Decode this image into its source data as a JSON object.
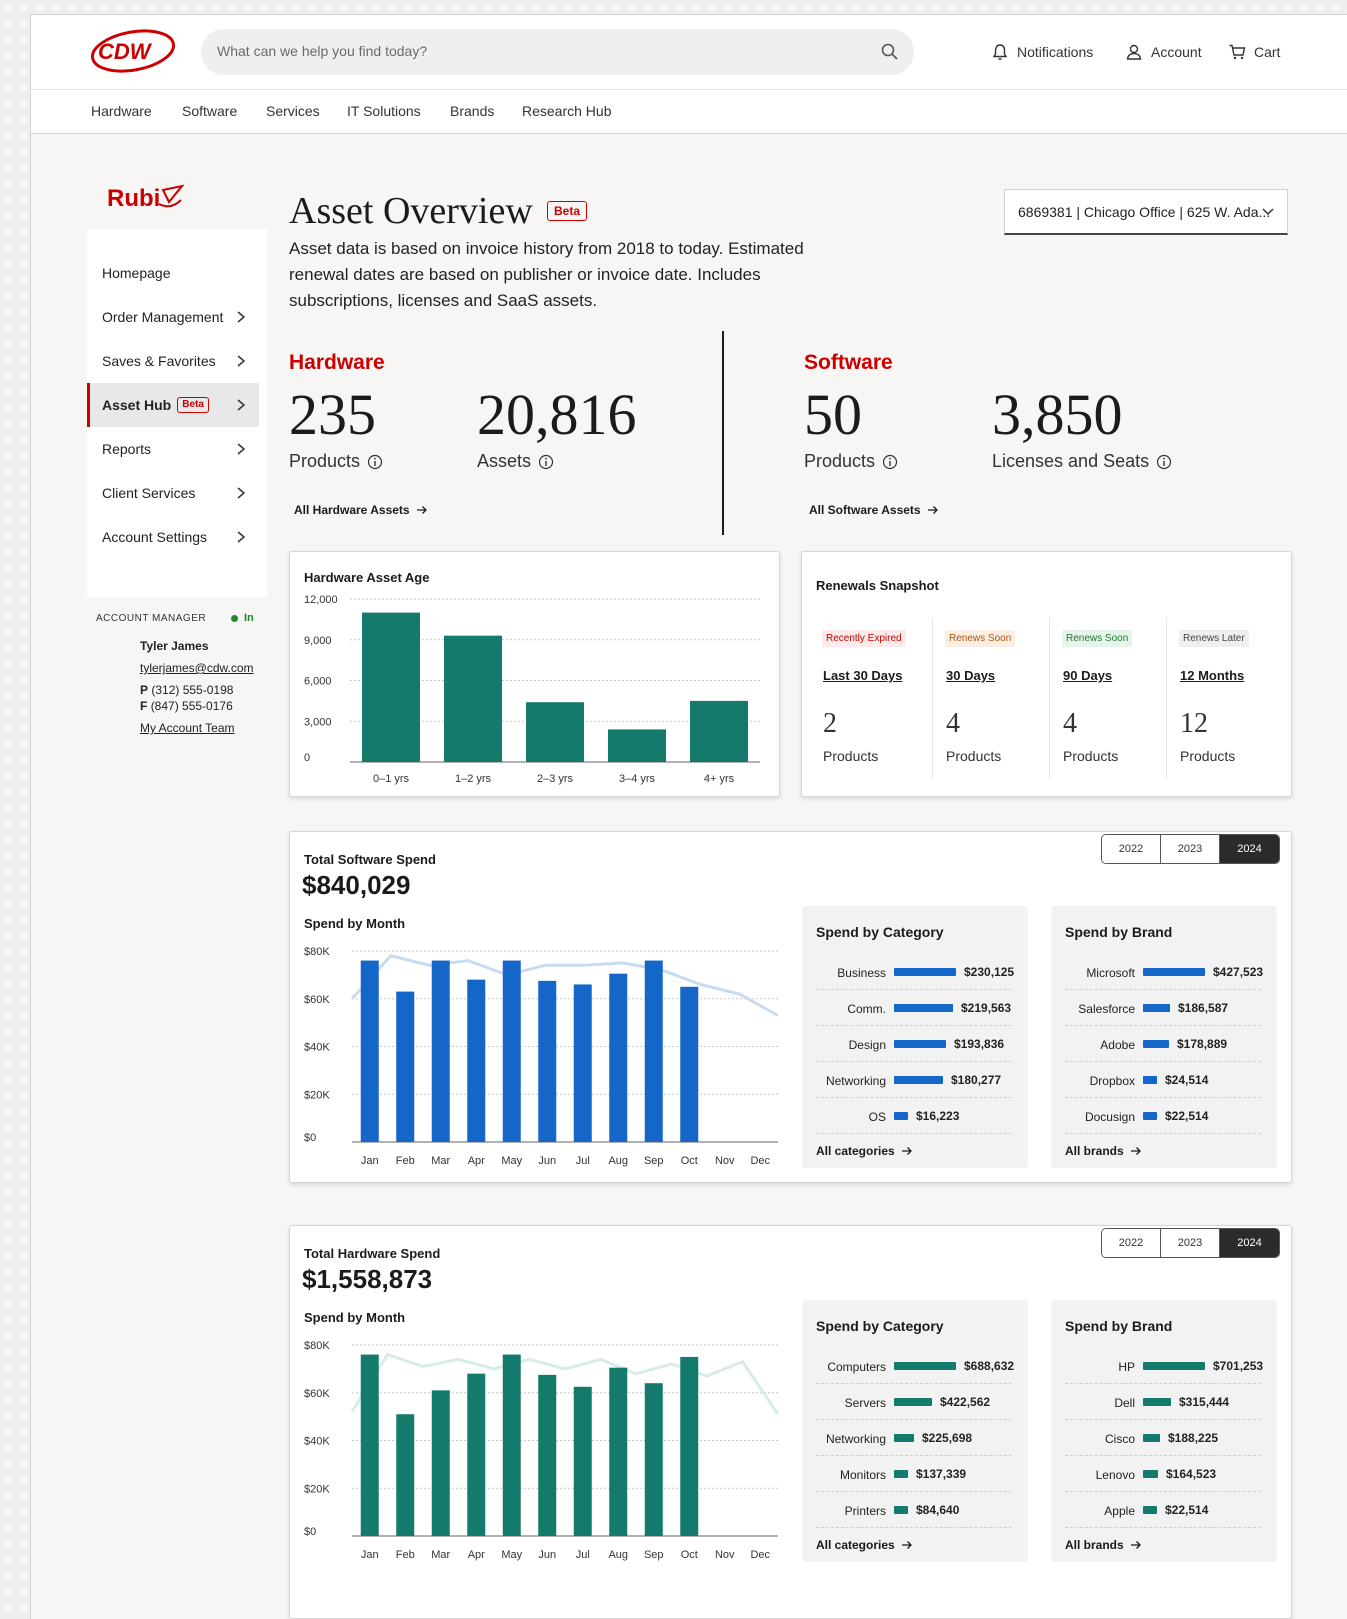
{
  "header": {
    "logo_text": "CDW",
    "search_placeholder": "What can we help you find today?",
    "notifications": "Notifications",
    "account": "Account",
    "cart": "Cart"
  },
  "nav": [
    "Hardware",
    "Software",
    "Services",
    "IT Solutions",
    "Brands",
    "Research Hub"
  ],
  "sidebar": {
    "brand": "Rubi",
    "items": [
      {
        "label": "Homepage"
      },
      {
        "label": "Order Management"
      },
      {
        "label": "Saves & Favorites"
      },
      {
        "label": "Asset Hub",
        "badge": "Beta"
      },
      {
        "label": "Reports"
      },
      {
        "label": "Client Services"
      },
      {
        "label": "Account Settings"
      }
    ],
    "account_manager": {
      "label": "ACCOUNT MANAGER",
      "status": "In",
      "name": "Tyler James",
      "email": "tylerjames@cdw.com",
      "phone_prefix": "P",
      "phone": "(312) 555-0198",
      "fax_prefix": "F",
      "fax": "(847) 555-0176",
      "team_link": "My Account Team"
    }
  },
  "page": {
    "title": "Asset Overview",
    "badge": "Beta",
    "intro": "Asset data is based on invoice history from 2018 to today. Estimated renewal dates are based on publisher or invoice date. Includes subscriptions, licenses and SaaS assets.",
    "office_select": "6869381 | Chicago Office | 625 W. Ada..."
  },
  "hardware": {
    "title": "Hardware",
    "products_value": "235",
    "products_label": "Products",
    "assets_value": "20,816",
    "assets_label": "Assets",
    "link": "All Hardware Assets"
  },
  "software": {
    "title": "Software",
    "products_value": "50",
    "products_label": "Products",
    "licenses_value": "3,850",
    "licenses_label": "Licenses and Seats",
    "link": "All Software Assets"
  },
  "asset_age": {
    "title": "Hardware  Asset Age",
    "colors": {
      "bar": "#137a6c"
    }
  },
  "renewals": {
    "title": "Renewals  Snapshot",
    "columns": [
      {
        "badge": "Recently Expired",
        "period": "Last 30 Days",
        "count": "2",
        "unit": "Products",
        "color": "#cc0000",
        "bg": "#fdeaea"
      },
      {
        "badge": "Renews Soon",
        "period": "30 Days",
        "count": "4",
        "unit": "Products",
        "color": "#b5520a",
        "bg": "#fbefe4"
      },
      {
        "badge": "Renews Soon",
        "period": "90 Days",
        "count": "4",
        "unit": "Products",
        "color": "#1e7a2e",
        "bg": "#e7f4e9"
      },
      {
        "badge": "Renews Later",
        "period": "12 Months",
        "count": "12",
        "unit": "Products",
        "color": "#444444",
        "bg": "#efefef"
      }
    ]
  },
  "software_spend": {
    "label": "Total Software Spend",
    "value": "$840,029",
    "month_title": "Spend by Month",
    "years": [
      "2022",
      "2023",
      "2024"
    ],
    "selected_year": "2024",
    "category": {
      "title": "Spend by Category",
      "link": "All categories",
      "rows": [
        {
          "label": "Business",
          "value": "$230,125",
          "amount": 230125
        },
        {
          "label": "Comm.",
          "value": "$219,563",
          "amount": 219563
        },
        {
          "label": "Design",
          "value": "$193,836",
          "amount": 193836
        },
        {
          "label": "Networking",
          "value": "$180,277",
          "amount": 180277
        },
        {
          "label": "OS",
          "value": "$16,223",
          "amount": 16223
        }
      ]
    },
    "brand": {
      "title": "Spend by Brand",
      "link": "All brands",
      "rows": [
        {
          "label": "Microsoft",
          "value": "$427,523",
          "amount": 427523
        },
        {
          "label": "Salesforce",
          "value": "$186,587",
          "amount": 186587
        },
        {
          "label": "Adobe",
          "value": "$178,889",
          "amount": 178889
        },
        {
          "label": "Dropbox",
          "value": "$24,514",
          "amount": 24514
        },
        {
          "label": "Docusign",
          "value": "$22,514",
          "amount": 22514
        }
      ]
    },
    "colors": {
      "bar": "#1467c8",
      "trend": "#c9dcef"
    }
  },
  "hardware_spend": {
    "label": "Total Hardware Spend",
    "value": "$1,558,873",
    "month_title": "Spend by Month",
    "years": [
      "2022",
      "2023",
      "2024"
    ],
    "selected_year": "2024",
    "category": {
      "title": "Spend by Category",
      "link": "All categories",
      "rows": [
        {
          "label": "Computers",
          "value": "$688,632",
          "amount": 688632
        },
        {
          "label": "Servers",
          "value": "$422,562",
          "amount": 422562
        },
        {
          "label": "Networking",
          "value": "$225,698",
          "amount": 225698
        },
        {
          "label": "Monitors",
          "value": "$137,339",
          "amount": 137339
        },
        {
          "label": "Printers",
          "value": "$84,640",
          "amount": 84640
        }
      ]
    },
    "brand": {
      "title": "Spend by Brand",
      "link": "All brands",
      "rows": [
        {
          "label": "HP",
          "value": "$701,253",
          "amount": 701253
        },
        {
          "label": "Dell",
          "value": "$315,444",
          "amount": 315444
        },
        {
          "label": "Cisco",
          "value": "$188,225",
          "amount": 188225
        },
        {
          "label": "Lenovo",
          "value": "$164,523",
          "amount": 164523
        },
        {
          "label": "Apple",
          "value": "$22,514",
          "amount": 22514
        }
      ]
    },
    "colors": {
      "bar": "#137a6c",
      "trend": "#d7ebe7"
    }
  },
  "chart_data": [
    {
      "type": "bar",
      "title": "Hardware  Asset Age",
      "categories": [
        "0–1 yrs",
        "1–2 yrs",
        "2–3 yrs",
        "3–4 yrs",
        "4+ yrs"
      ],
      "values": [
        11000,
        9300,
        4400,
        2400,
        4500
      ],
      "yticks": [
        "12,000",
        "9,000",
        "6,000",
        "3,000",
        "0"
      ],
      "ylim": [
        0,
        12000
      ],
      "grid": true
    },
    {
      "type": "bar",
      "title": "Spend by Month",
      "categories": [
        "Jan",
        "Feb",
        "Mar",
        "Apr",
        "May",
        "Jun",
        "Jul",
        "Aug",
        "Sep",
        "Oct",
        "Nov",
        "Dec"
      ],
      "values": [
        76000,
        63000,
        76000,
        68000,
        76000,
        67500,
        66000,
        70500,
        76000,
        65000,
        null,
        null
      ],
      "trend": [
        60000,
        78000,
        74000,
        76000,
        70000,
        74000,
        74000,
        75000,
        72000,
        66000,
        62000,
        53000
      ],
      "yticks": [
        "$80K",
        "$60K",
        "$40K",
        "$20K",
        "$0"
      ],
      "ylim": [
        0,
        80000
      ],
      "grid": true
    },
    {
      "type": "bar",
      "title": "Spend by Month",
      "categories": [
        "Jan",
        "Feb",
        "Mar",
        "Apr",
        "May",
        "Jun",
        "Jul",
        "Aug",
        "Sep",
        "Oct",
        "Nov",
        "Dec"
      ],
      "values": [
        76000,
        51000,
        61000,
        68000,
        76000,
        67500,
        62500,
        70500,
        64000,
        75000,
        null,
        null
      ],
      "trend": [
        52000,
        76000,
        71000,
        74000,
        70000,
        74000,
        70000,
        74000,
        68000,
        72000,
        67000,
        73000,
        51000
      ],
      "yticks": [
        "$80K",
        "$60K",
        "$40K",
        "$20K",
        "$0"
      ],
      "ylim": [
        0,
        80000
      ],
      "grid": true
    }
  ]
}
